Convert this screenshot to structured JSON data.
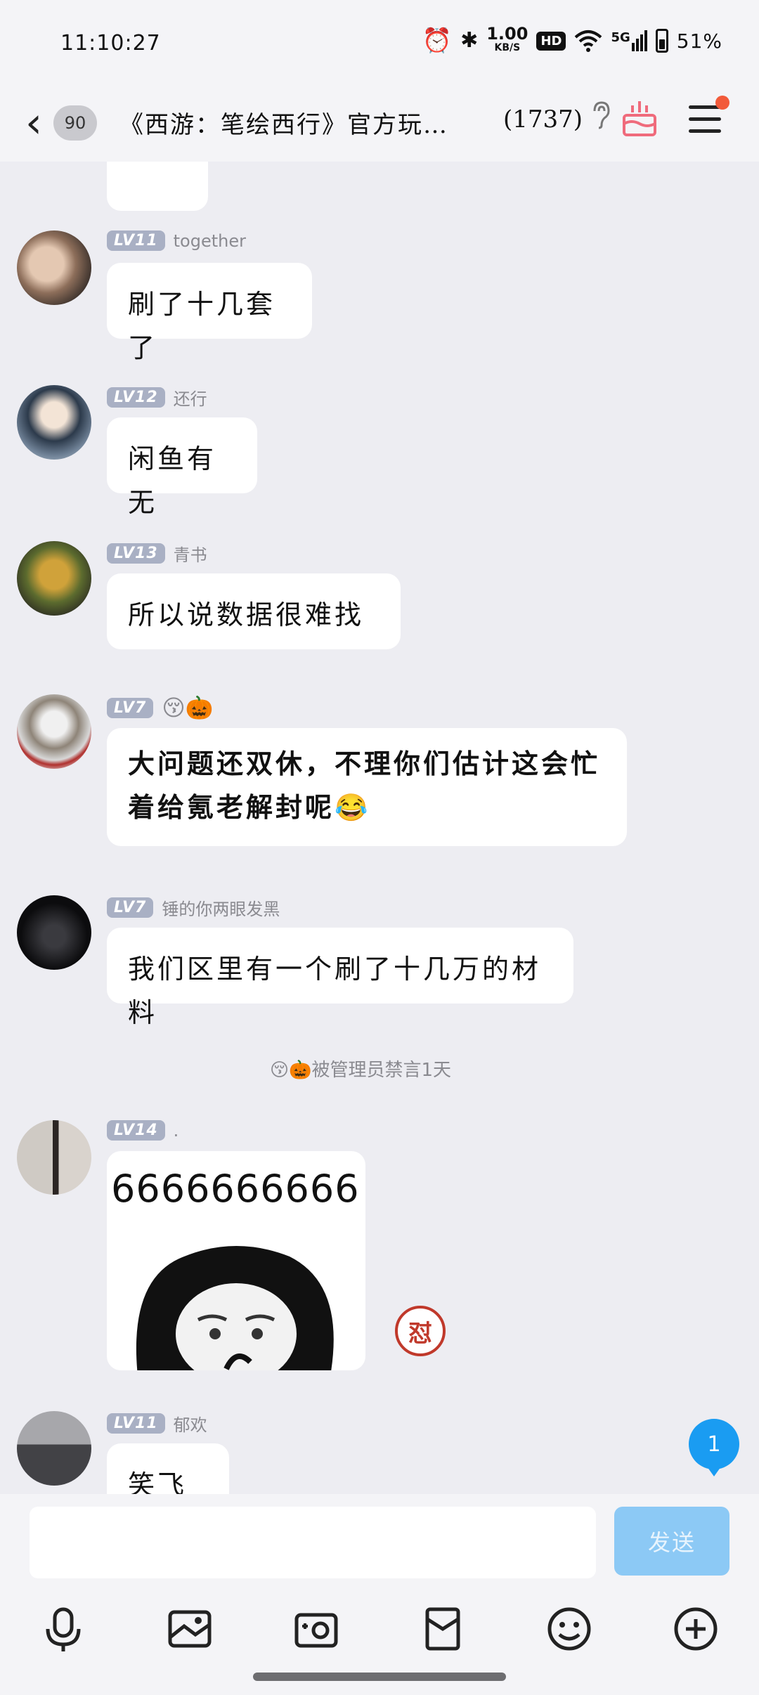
{
  "status": {
    "time": "11:10:27",
    "speed_num": "1.00",
    "speed_unit": "KB/S",
    "hd": "HD",
    "network": "5G",
    "battery": "51%",
    "battery_level": 0.51
  },
  "nav": {
    "back_count": "90",
    "title": "《西游：笔绘西行》官方玩…",
    "member_count": "(1737)"
  },
  "messages": [
    {
      "level": "LV11",
      "nick": "together",
      "text": "刷了十几套了"
    },
    {
      "level": "LV12",
      "nick": "还行",
      "text": "闲鱼有无"
    },
    {
      "level": "LV13",
      "nick": "青书",
      "text": "所以说数据很难找"
    },
    {
      "level": "LV7",
      "nick": "😚🎃",
      "text": "大问题还双休，不理你们估计这会忙着给氪老解封呢😂"
    },
    {
      "level": "LV7",
      "nick": "锤的你两眼发黑",
      "text": "我们区里有一个刷了十几万的材料"
    },
    {
      "level": "LV14",
      "nick": ".",
      "sticker_text": "6666666666"
    },
    {
      "level": "LV11",
      "nick": "郁欢",
      "text": "笑飞了"
    }
  ],
  "system_notice": "😚🎃被管理员禁言1天",
  "reaction": "怼",
  "new_message_count": "1",
  "input": {
    "placeholder": "",
    "send_label": "发送"
  },
  "toolbar": {
    "items": [
      "microphone-icon",
      "image-icon",
      "camera-icon",
      "red-packet-icon",
      "emoji-icon",
      "plus-icon"
    ]
  }
}
